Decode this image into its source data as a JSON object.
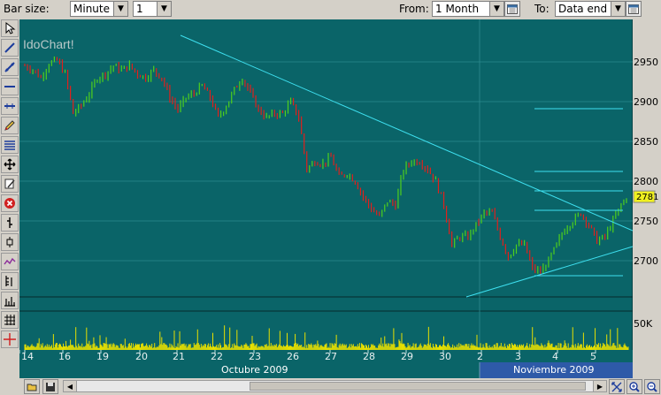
{
  "toolbar_top": {
    "bar_size_label": "Bar size:",
    "bar_unit": "Minute",
    "bar_count": "1",
    "from_label": "From:",
    "from_value": "1 Month",
    "to_label": "To:",
    "to_value": "Data end"
  },
  "chart": {
    "watermark": "IdoChart!",
    "last_price_label": "2781",
    "colors": {
      "background": "#0a6468",
      "up": "#4ecf1c",
      "down": "#e0201c",
      "trendline": "#3ee0f0",
      "volume": "#e8e000",
      "price_tag": "#f0f020"
    }
  },
  "chart_data": {
    "type": "candlestick",
    "y_ticks": [
      "2950",
      "2900",
      "2850",
      "2800",
      "2750",
      "2700"
    ],
    "volume_tick": "50K",
    "x_ticks": [
      "14",
      "16",
      "19",
      "20",
      "21",
      "22",
      "23",
      "26",
      "27",
      "28",
      "29",
      "30",
      "2",
      "3",
      "4",
      "5"
    ],
    "months": [
      "Octubre 2009",
      "Noviembre 2009"
    ],
    "last_price": 2781,
    "ylim": [
      2655,
      2975
    ],
    "path": [
      [
        0,
        2945
      ],
      [
        3,
        2940
      ],
      [
        6,
        2930
      ],
      [
        9,
        2948
      ],
      [
        12,
        2952
      ],
      [
        15,
        2935
      ],
      [
        18,
        2885
      ],
      [
        21,
        2895
      ],
      [
        24,
        2910
      ],
      [
        27,
        2930
      ],
      [
        30,
        2935
      ],
      [
        33,
        2945
      ],
      [
        36,
        2940
      ],
      [
        39,
        2945
      ],
      [
        42,
        2935
      ],
      [
        45,
        2930
      ],
      [
        48,
        2940
      ],
      [
        51,
        2930
      ],
      [
        54,
        2905
      ],
      [
        57,
        2890
      ],
      [
        60,
        2905
      ],
      [
        63,
        2910
      ],
      [
        66,
        2920
      ],
      [
        69,
        2905
      ],
      [
        72,
        2880
      ],
      [
        75,
        2895
      ],
      [
        78,
        2915
      ],
      [
        81,
        2930
      ],
      [
        84,
        2910
      ],
      [
        87,
        2890
      ],
      [
        90,
        2880
      ],
      [
        93,
        2885
      ],
      [
        96,
        2885
      ],
      [
        99,
        2900
      ],
      [
        102,
        2880
      ],
      [
        105,
        2815
      ],
      [
        108,
        2825
      ],
      [
        111,
        2822
      ],
      [
        114,
        2830
      ],
      [
        117,
        2805
      ],
      [
        120,
        2810
      ],
      [
        123,
        2800
      ],
      [
        126,
        2780
      ],
      [
        129,
        2765
      ],
      [
        132,
        2755
      ],
      [
        135,
        2775
      ],
      [
        138,
        2770
      ],
      [
        141,
        2815
      ],
      [
        144,
        2825
      ],
      [
        147,
        2825
      ],
      [
        150,
        2815
      ],
      [
        153,
        2800
      ],
      [
        156,
        2770
      ],
      [
        159,
        2720
      ],
      [
        162,
        2730
      ],
      [
        165,
        2730
      ],
      [
        168,
        2745
      ],
      [
        171,
        2760
      ],
      [
        174,
        2760
      ],
      [
        177,
        2730
      ],
      [
        180,
        2705
      ],
      [
        183,
        2720
      ],
      [
        186,
        2720
      ],
      [
        189,
        2690
      ],
      [
        192,
        2685
      ],
      [
        195,
        2700
      ],
      [
        198,
        2720
      ],
      [
        201,
        2740
      ],
      [
        204,
        2750
      ],
      [
        207,
        2760
      ],
      [
        210,
        2745
      ],
      [
        213,
        2725
      ],
      [
        216,
        2730
      ],
      [
        219,
        2750
      ],
      [
        222,
        2770
      ],
      [
        225,
        2785
      ]
    ],
    "n": 225
  },
  "bottom": {
    "bold_on": false
  }
}
